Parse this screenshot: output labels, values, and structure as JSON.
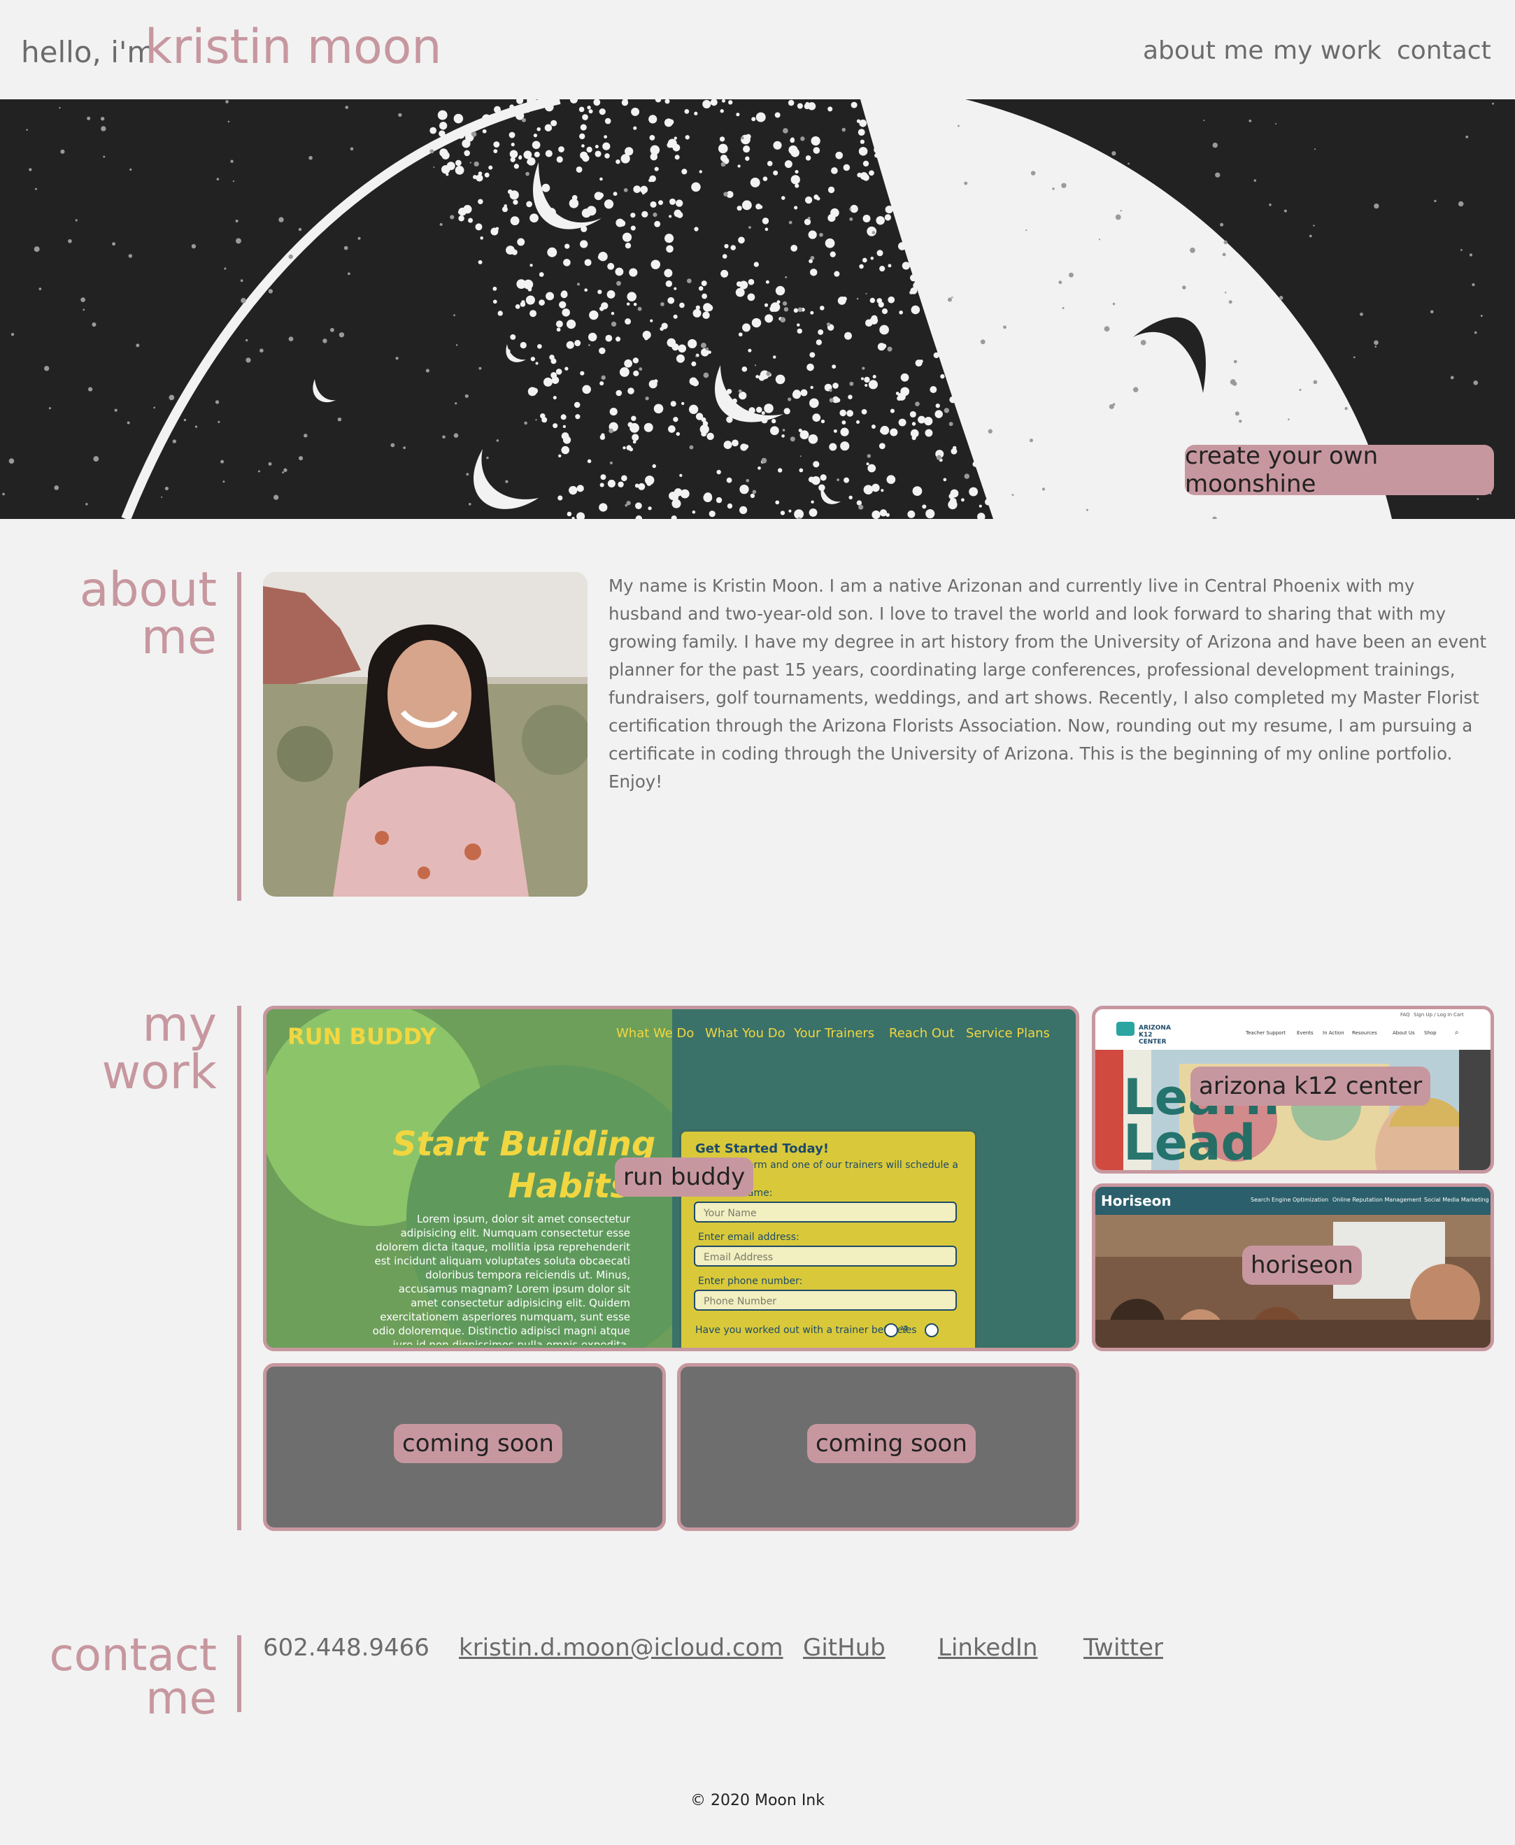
{
  "header": {
    "greeting": "hello, i'm",
    "name": "kristin moon",
    "nav": [
      "about me",
      "my work",
      "contact"
    ]
  },
  "hero": {
    "button_label": "create your own moonshine"
  },
  "about": {
    "title": "about me",
    "bio": "My name is Kristin Moon. I am a native Arizonan and currently live in Central Phoenix with my husband and two-year-old son. I love to travel the world and look forward to sharing that with my growing family. I have my degree in art history from the University of Arizona and have been an event planner for the past 15 years, coordinating large conferences, professional development trainings, fundraisers, golf tournaments, weddings, and art shows. Recently, I also completed my Master Florist certification through the Arizona Florists Association. Now, rounding out my resume, I am pursuing a certificate in coding through the University of Arizona. This is the beginning of my online portfolio. Enjoy!"
  },
  "work": {
    "title": "my work",
    "projects": [
      {
        "label": "run buddy",
        "preview": {
          "brand": "RUN BUDDY",
          "nav": [
            "What We Do",
            "What You Do",
            "Your Trainers",
            "Reach Out",
            "Service Plans"
          ],
          "headline1": "Start Building",
          "headline2": "Habits",
          "body": "Lorem ipsum, dolor sit amet consectetur adipisicing elit. Numquam consectetur esse dolorem dicta itaque, mollitia ipsa reprehenderit est incidunt aliquam voluptates soluta obcaecati doloribus tempora reiciendis ut. Minus, accusamus magnam? Lorem ipsum dolor sit amet consectetur adipisicing elit. Quidem exercitationem asperiores numquam, sunt esse odio doloremque. Distinctio adipisci magni atque iure id non dignissimos nulla omnis expedita, rem",
          "form_title": "Get Started Today!",
          "form_sub": "this form and one of our trainers will schedule a",
          "name_label": "full name:",
          "name_ph": "Your Name",
          "email_label": "Enter email address:",
          "email_ph": "Email Address",
          "phone_label": "Enter phone number:",
          "phone_ph": "Phone Number",
          "question": "Have you worked out with a trainer before?",
          "yes": "Yes"
        }
      },
      {
        "label": "arizona k12 center",
        "preview": {
          "logo": "ARIZONA K12 CENTER",
          "toplinks": [
            "FAQ",
            "Sign Up / Log In",
            "Cart"
          ],
          "nav": [
            "Teacher Support",
            "Events",
            "In Action",
            "Resources",
            "About Us",
            "Shop"
          ],
          "big1": "Learn",
          "big2": "Lead"
        }
      },
      {
        "label": "horiseon",
        "preview": {
          "brand": "Horiseon",
          "nav": [
            "Search Engine Optimization",
            "Online Reputation Management",
            "Social Media Marketing"
          ]
        }
      },
      {
        "label": "coming soon"
      },
      {
        "label": "coming soon"
      }
    ]
  },
  "contact": {
    "title_line1": "contact",
    "title_line2": "me",
    "phone": "602.448.9466",
    "email": "kristin.d.moon@icloud.com",
    "links": [
      "GitHub",
      "LinkedIn",
      "Twitter"
    ]
  },
  "footer": {
    "copyright": "© 2020 Moon Ink"
  },
  "colors": {
    "accent": "#c7979f",
    "background": "#f2f2f2",
    "text": "#6b6b6b",
    "hero_bg": "#222222"
  }
}
